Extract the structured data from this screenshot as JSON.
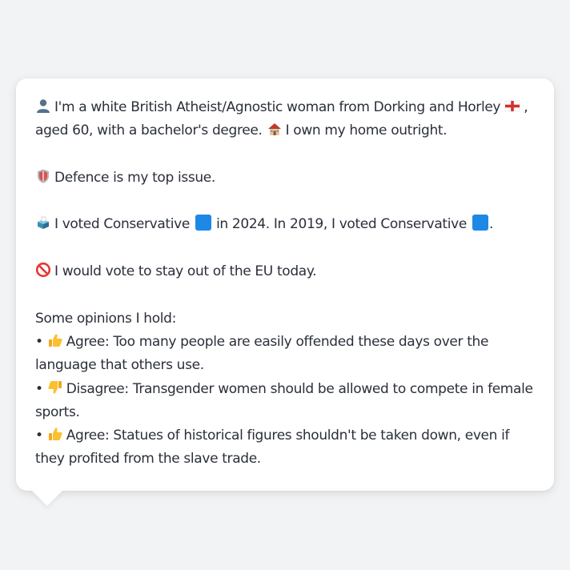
{
  "profile": {
    "line1a": "I'm a white British Atheist/Agnostic woman from Dorking and Horley",
    "line1b": ",",
    "line2": "aged 60, with a bachelor's degree.",
    "line2b": "I own my home outright."
  },
  "issue": {
    "text": "Defence is my top issue."
  },
  "vote": {
    "a": "I voted Conservative",
    "b": "in 2024. In 2019, I voted Conservative",
    "c": "."
  },
  "eu": {
    "text": "I would vote to stay out of the EU today."
  },
  "opinions": {
    "heading": "Some opinions I hold:",
    "items": [
      {
        "bullet": "•",
        "stance": "Agree:",
        "text": "Too many people are easily offended these days over the language that others use."
      },
      {
        "bullet": "•",
        "stance": "Disagree:",
        "text": "Transgender women should be allowed to compete in female sports."
      },
      {
        "bullet": "•",
        "stance": "Agree:",
        "text": "Statues of historical figures shouldn't be taken down, even if they profited from the slave trade."
      }
    ]
  },
  "icons": {
    "person": "bust-in-silhouette-icon",
    "england_flag": "england-flag-icon",
    "house": "house-icon",
    "shield": "shield-icon",
    "ballot": "ballot-box-icon",
    "blue_square": "blue-square-icon",
    "no_entry": "prohibited-icon",
    "thumbs_up": "thumbs-up-icon",
    "thumbs_down": "thumbs-down-icon"
  },
  "colors": {
    "background": "#f2f3f5",
    "card": "#ffffff",
    "text": "#2a2f3a",
    "conservative_blue": "#1e88e5"
  }
}
